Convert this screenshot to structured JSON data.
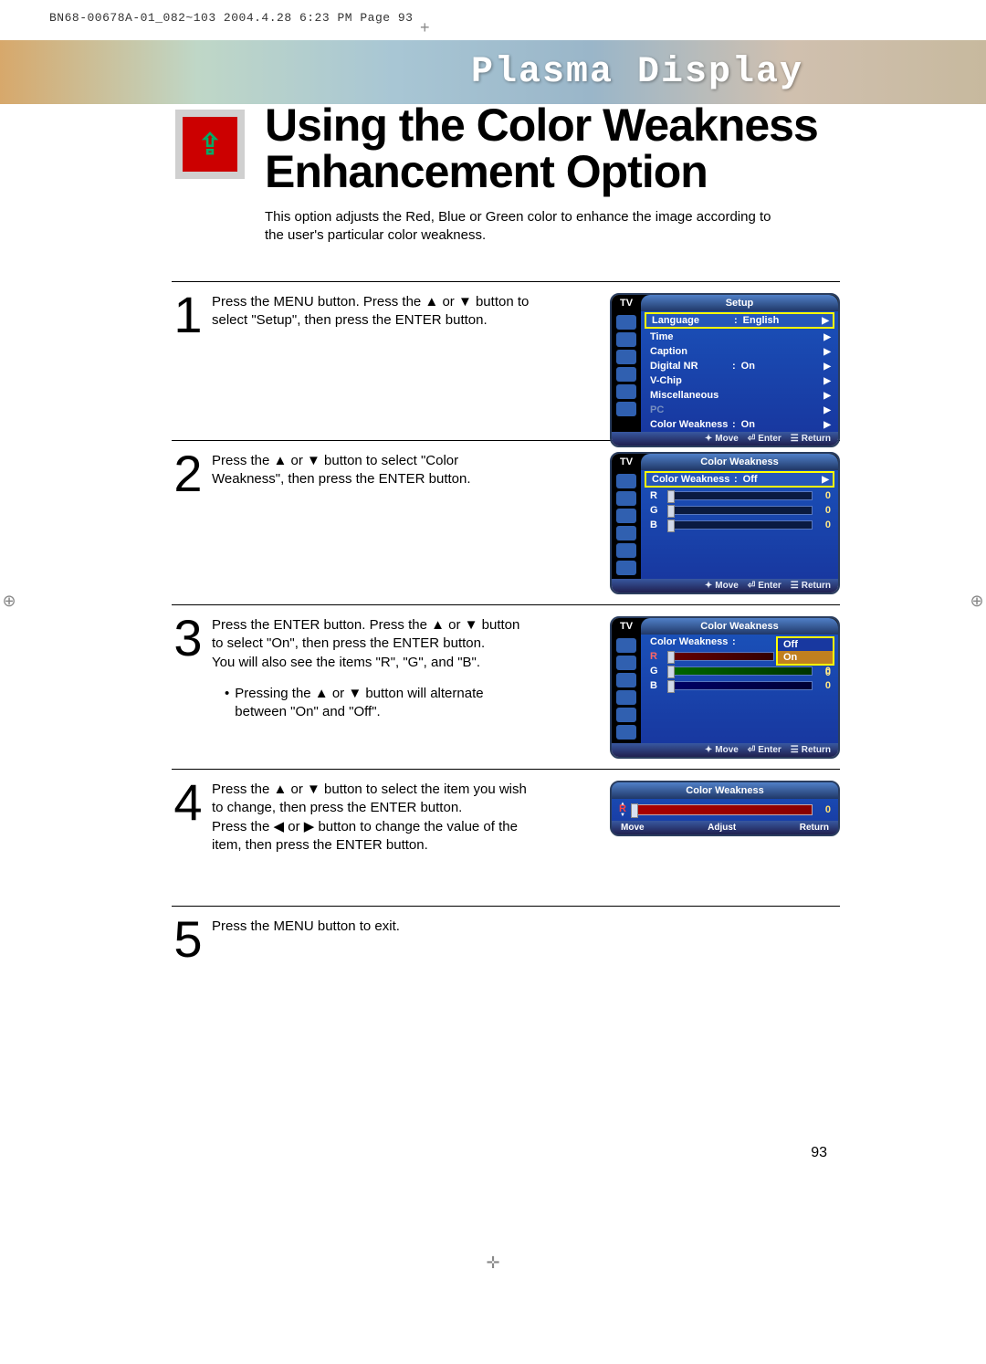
{
  "header_print": "BN68-00678A-01_082~103  2004.4.28  6:23 PM  Page 93",
  "banner_title": "Plasma Display",
  "title_line1": "Using the Color Weakness",
  "title_line2": "Enhancement Option",
  "intro": "This option adjusts the Red, Blue or Green color to enhance the image according to the user's particular color weakness.",
  "steps": {
    "s1": {
      "num": "1",
      "text": "Press the MENU button. Press the ▲ or ▼ button to select \"Setup\", then press the ENTER button."
    },
    "s2": {
      "num": "2",
      "text": "Press the ▲ or ▼ button to select \"Color Weakness\", then press the ENTER button."
    },
    "s3": {
      "num": "3",
      "text1": "Press the ENTER button. Press the ▲ or ▼ button to select \"On\", then press the ENTER button.",
      "text2": "You will also see the items \"R\", \"G\", and \"B\".",
      "bullet": "Pressing the ▲ or ▼ button will alternate between \"On\" and \"Off\"."
    },
    "s4": {
      "num": "4",
      "text1": "Press the ▲ or ▼ button to select the item you wish to change, then press the ENTER button.",
      "text2": "Press the ◀ or ▶ button to change the value of the item, then press the ENTER button."
    },
    "s5": {
      "num": "5",
      "text": "Press the MENU button to exit."
    }
  },
  "osd_common": {
    "tv": "TV",
    "footer_move": "Move",
    "footer_enter": "Enter",
    "footer_adjust": "Adjust",
    "footer_return": "Return",
    "arrow": "▶"
  },
  "osd1": {
    "title": "Setup",
    "items": [
      {
        "label": "Language",
        "val": "English",
        "hl": true
      },
      {
        "label": "Time",
        "val": ""
      },
      {
        "label": "Caption",
        "val": ""
      },
      {
        "label": "Digital NR",
        "val": "On"
      },
      {
        "label": "V-Chip",
        "val": ""
      },
      {
        "label": "Miscellaneous",
        "val": ""
      },
      {
        "label": "PC",
        "val": "",
        "dim": true
      },
      {
        "label": "Color Weakness",
        "val": "On"
      }
    ]
  },
  "osd2": {
    "title": "Color Weakness",
    "row": {
      "label": "Color Weakness",
      "val": "Off"
    },
    "sliders": [
      {
        "ch": "R",
        "num": "0"
      },
      {
        "ch": "G",
        "num": "0"
      },
      {
        "ch": "B",
        "num": "0"
      }
    ]
  },
  "osd3": {
    "title": "Color Weakness",
    "row_label": "Color Weakness",
    "select": {
      "off": "Off",
      "on": "On"
    },
    "sliders": [
      {
        "ch": "R",
        "num": "0",
        "color": "r"
      },
      {
        "ch": "G",
        "num": "0",
        "color": "g"
      },
      {
        "ch": "B",
        "num": "0",
        "color": "b"
      }
    ]
  },
  "osd4": {
    "title": "Color Weakness",
    "ch": "R",
    "num": "0"
  },
  "page_number": "93"
}
